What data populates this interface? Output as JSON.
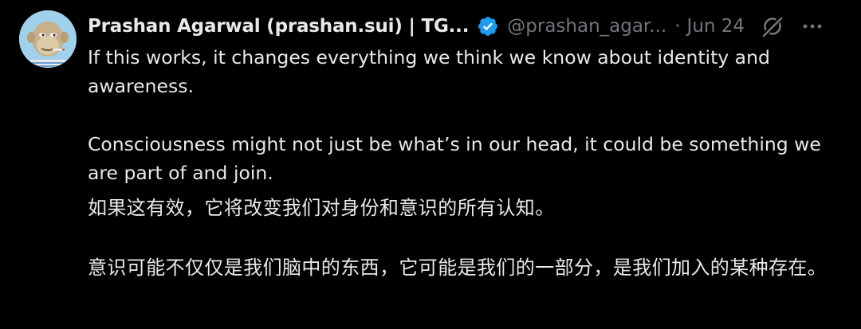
{
  "author": {
    "display_name": "Prashan Agarwal (prashan.sui) | TG...",
    "handle": "@prashan_agar...",
    "separator": "·",
    "date": "Jun 24"
  },
  "icons": {
    "verified": "verified-badge-icon",
    "grok": "grok-icon",
    "more": "more-options-icon"
  },
  "colors": {
    "background": "#000000",
    "text": "#e7e9ea",
    "muted": "#71767b",
    "verified_blue": "#1d9bf0"
  },
  "tweet": {
    "english": [
      "If this works, it changes everything we think we know about identity and awareness.",
      "Consciousness might not just be what’s in our head, it could be something we are part of and join."
    ],
    "chinese": [
      "如果这有效，它将改变我们对身份和意识的所有认知。",
      "意识可能不仅仅是我们脑中的东西，它可能是我们的一部分，是我们加入的某种存在。"
    ]
  }
}
